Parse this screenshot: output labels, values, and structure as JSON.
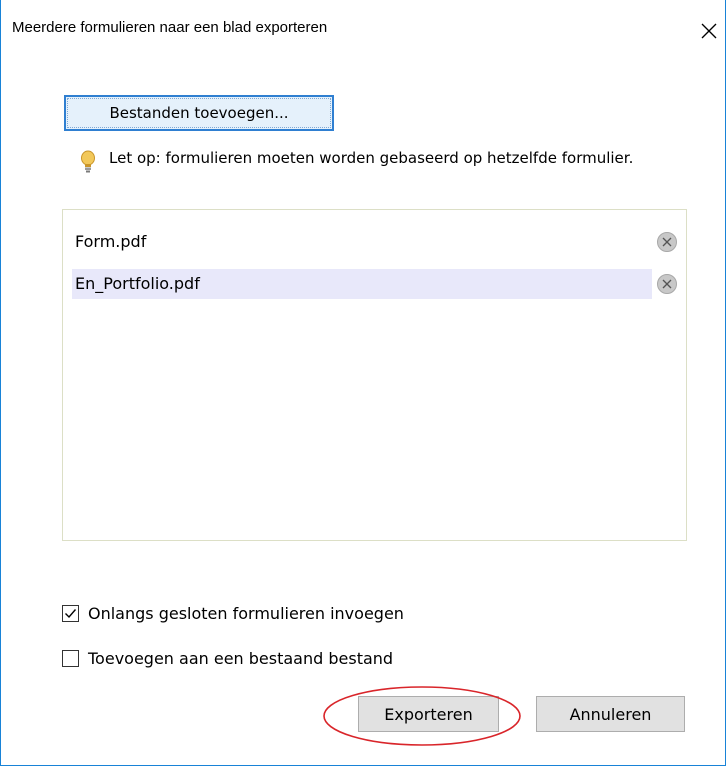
{
  "dialog": {
    "title": "Meerdere formulieren naar een blad exporteren",
    "close_icon": "close-icon"
  },
  "add_files_button": {
    "label": "Bestanden toevoegen..."
  },
  "hint": {
    "icon": "lightbulb-icon",
    "text": "Let op: formulieren moeten worden gebaseerd op hetzelfde formulier."
  },
  "file_list": {
    "items": [
      {
        "name": "Form.pdf",
        "selected": false,
        "remove_icon": "remove-circle-icon"
      },
      {
        "name": "En_Portfolio.pdf",
        "selected": true,
        "remove_icon": "remove-circle-icon"
      }
    ]
  },
  "options": [
    {
      "label": "Onlangs gesloten formulieren invoegen",
      "checked": true
    },
    {
      "label": "Toevoegen aan een bestaand bestand",
      "checked": false
    }
  ],
  "buttons": {
    "export": "Exporteren",
    "cancel": "Annuleren"
  },
  "colors": {
    "window_border": "#1883d7",
    "primary_button_border": "#2f7fd1",
    "selected_row": "#e8e8fa",
    "annotation_ellipse": "#d9252a"
  }
}
